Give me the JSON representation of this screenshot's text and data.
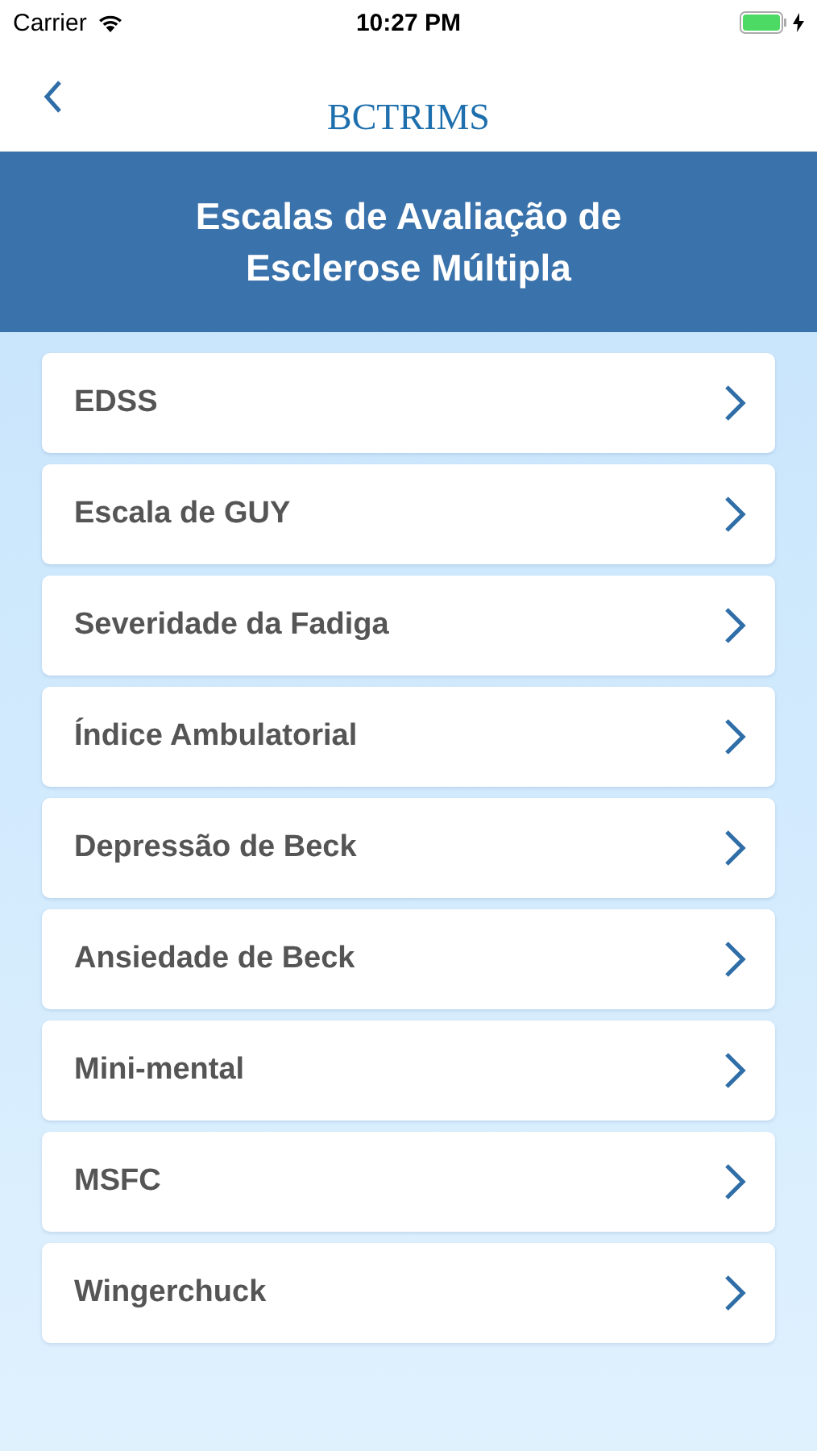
{
  "status_bar": {
    "carrier": "Carrier",
    "time": "10:27 PM"
  },
  "nav_bar": {
    "logo": "BCTRIMS"
  },
  "header": {
    "title": "Escalas de Avaliação de Esclerose Múltipla"
  },
  "items": [
    {
      "label": "EDSS"
    },
    {
      "label": "Escala de GUY"
    },
    {
      "label": "Severidade da Fadiga"
    },
    {
      "label": "Índice Ambulatorial"
    },
    {
      "label": "Depressão de Beck"
    },
    {
      "label": "Ansiedade de Beck"
    },
    {
      "label": "Mini-mental"
    },
    {
      "label": "MSFC"
    },
    {
      "label": "Wingerchuck"
    }
  ]
}
